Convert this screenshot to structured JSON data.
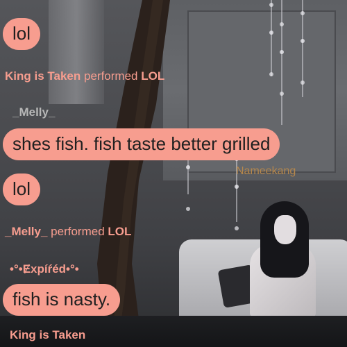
{
  "world": {
    "floating_nametag": "Nameekang"
  },
  "colors": {
    "bubble": "#f79d8f",
    "system_text": "#f79d8f",
    "dim_name": "#b7b7b7"
  },
  "chat": {
    "messages": [
      {
        "kind": "bubble",
        "text": "lol"
      },
      {
        "kind": "system",
        "who": "King is Taken",
        "verb": "performed",
        "action": "LOL"
      },
      {
        "kind": "name",
        "text": "_Melly_"
      },
      {
        "kind": "bubble",
        "text": "shes fish. fish taste better grilled"
      },
      {
        "kind": "bubble",
        "text": "lol"
      },
      {
        "kind": "system",
        "who": "_Melly_",
        "verb": "performed",
        "action": "LOL"
      },
      {
        "kind": "name",
        "text": "•°•Ɇxpíŕéd•°•"
      },
      {
        "kind": "bubble",
        "text": "fish is nasty."
      },
      {
        "kind": "name",
        "text": "King is Taken"
      }
    ]
  }
}
